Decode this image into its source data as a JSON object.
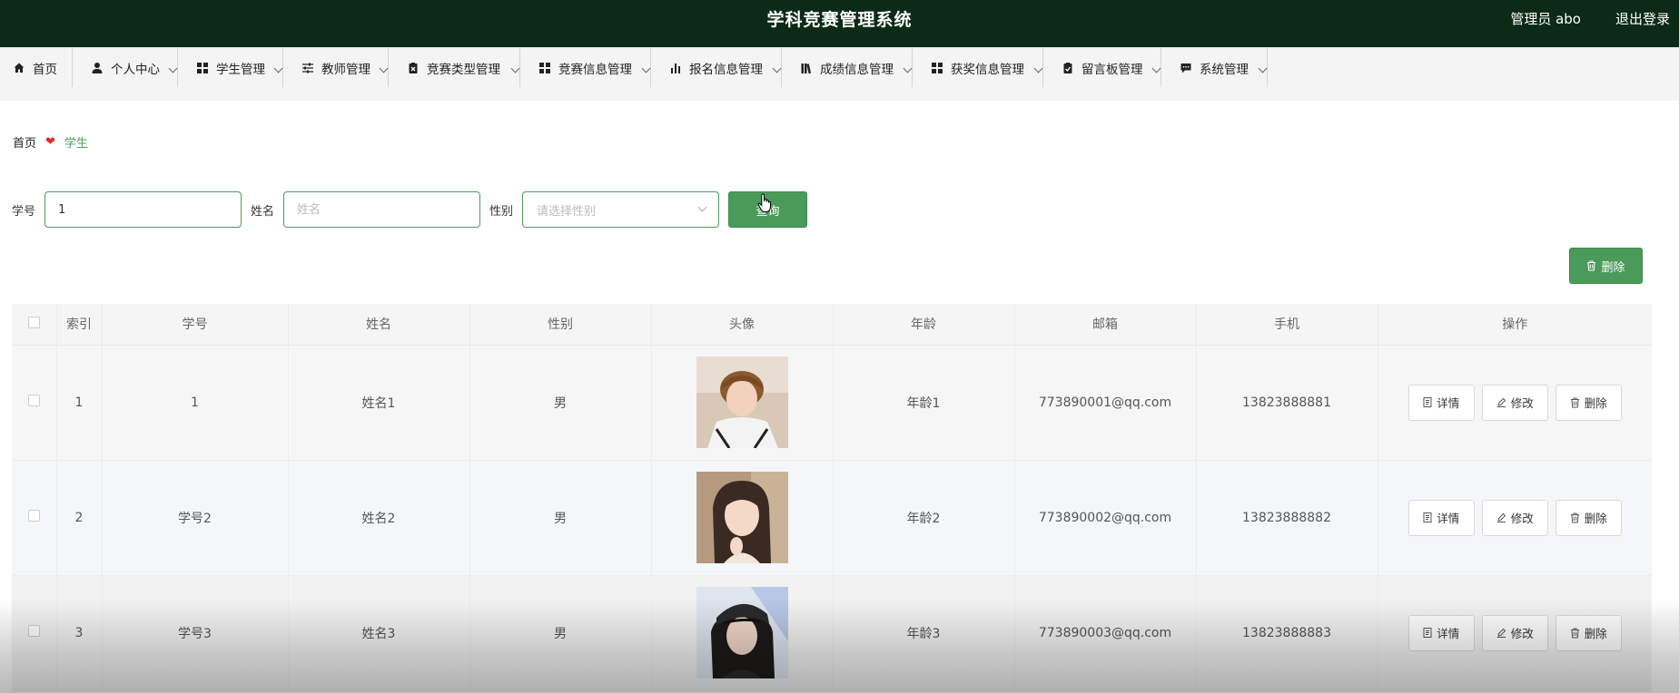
{
  "header": {
    "title": "学科竞赛管理系统",
    "user_label": "管理员 abo",
    "logout_label": "退出登录"
  },
  "nav": {
    "items": [
      {
        "label": "首页",
        "icon": "home-icon",
        "has_dropdown": false
      },
      {
        "label": "个人中心",
        "icon": "user-icon",
        "has_dropdown": true
      },
      {
        "label": "学生管理",
        "icon": "grid-icon",
        "has_dropdown": true
      },
      {
        "label": "教师管理",
        "icon": "sliders-icon",
        "has_dropdown": true
      },
      {
        "label": "竞赛类型管理",
        "icon": "clipboard-x-icon",
        "has_dropdown": true
      },
      {
        "label": "竞赛信息管理",
        "icon": "grid-icon",
        "has_dropdown": true
      },
      {
        "label": "报名信息管理",
        "icon": "bar-chart-icon",
        "has_dropdown": true
      },
      {
        "label": "成绩信息管理",
        "icon": "books-icon",
        "has_dropdown": true
      },
      {
        "label": "获奖信息管理",
        "icon": "grid-icon",
        "has_dropdown": true
      },
      {
        "label": "留言板管理",
        "icon": "clipboard-check-icon",
        "has_dropdown": true
      },
      {
        "label": "系统管理",
        "icon": "chat-icon",
        "has_dropdown": true
      }
    ]
  },
  "breadcrumb": {
    "home": "首页",
    "current": "学生"
  },
  "search": {
    "student_id_label": "学号",
    "student_id_value": "1",
    "name_label": "姓名",
    "name_placeholder": "姓名",
    "gender_label": "性别",
    "gender_placeholder": "请选择性别",
    "query_button": "查询"
  },
  "toolbar": {
    "delete_button": "删除"
  },
  "table": {
    "columns": [
      "索引",
      "学号",
      "姓名",
      "性别",
      "头像",
      "年龄",
      "邮箱",
      "手机",
      "操作"
    ],
    "rows": [
      {
        "index": "1",
        "student_id": "1",
        "name": "姓名1",
        "gender": "男",
        "age": "年龄1",
        "email": "773890001@qq.com",
        "phone": "13823888881"
      },
      {
        "index": "2",
        "student_id": "学号2",
        "name": "姓名2",
        "gender": "男",
        "age": "年龄2",
        "email": "773890002@qq.com",
        "phone": "13823888882"
      },
      {
        "index": "3",
        "student_id": "学号3",
        "name": "姓名3",
        "gender": "男",
        "age": "年龄3",
        "email": "773890003@qq.com",
        "phone": "13823888883"
      }
    ],
    "actions": {
      "detail": "详情",
      "edit": "修改",
      "delete": "删除"
    }
  },
  "colors": {
    "header_bg": "#0b2b17",
    "accent_green": "#4a9b5a",
    "heart_red": "#e02b2b"
  }
}
